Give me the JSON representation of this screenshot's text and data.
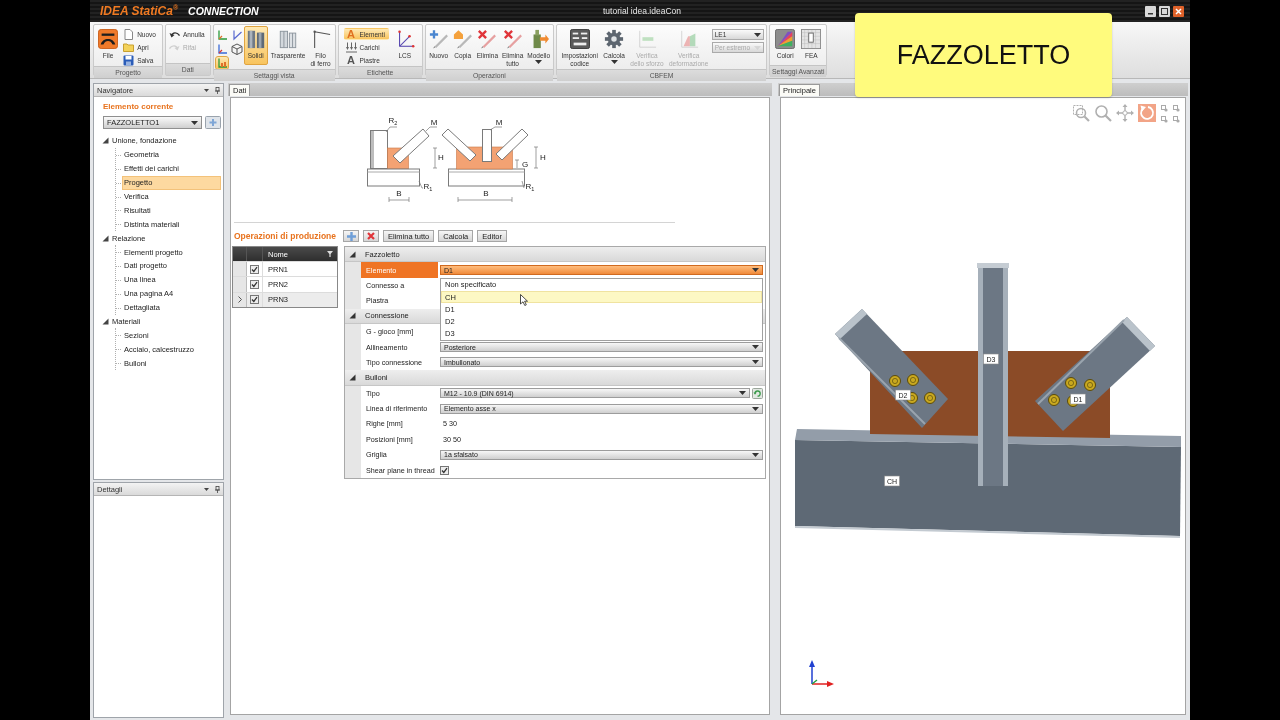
{
  "title_bar": {
    "brand": "IDEA StatiCa$^{®}$",
    "product": "CONNECTION",
    "title": "tutorial idea.ideaCon"
  },
  "ribbon": {
    "groups": [
      {
        "label": "Progetto",
        "items": [
          {
            "kind": "large",
            "label": "File",
            "selected": false,
            "disabled": false
          },
          {
            "kind": "small",
            "label": "Nuovo",
            "selected": false,
            "disabled": false
          },
          {
            "kind": "small",
            "label": "Apri",
            "selected": false,
            "disabled": false
          },
          {
            "kind": "small",
            "label": "Salva",
            "selected": false,
            "disabled": false
          }
        ]
      },
      {
        "label": "Dati",
        "items": [
          {
            "kind": "small",
            "label": "Annulla",
            "selected": false,
            "disabled": false
          },
          {
            "kind": "small",
            "label": "Rifai",
            "selected": false,
            "disabled": true
          }
        ]
      },
      {
        "label": "Settaggi vista",
        "items": [
          {
            "kind": "icon",
            "selected": false,
            "disabled": false
          },
          {
            "kind": "icon",
            "selected": false,
            "disabled": false
          },
          {
            "kind": "icon",
            "selected": false,
            "disabled": false
          },
          {
            "kind": "icon",
            "selected": false,
            "disabled": false
          },
          {
            "kind": "icon",
            "selected": true,
            "disabled": false
          },
          {
            "kind": "large",
            "label": "Solidi",
            "selected": true,
            "disabled": false
          },
          {
            "kind": "large",
            "label": "Trasparente",
            "selected": false,
            "disabled": false
          },
          {
            "kind": "large",
            "label": "Filo\ndi ferro",
            "selected": false,
            "disabled": false
          }
        ]
      },
      {
        "label": "Etichette",
        "items": [
          {
            "kind": "small",
            "label": "Elementi",
            "glyph": "A",
            "selected": true,
            "disabled": false
          },
          {
            "kind": "small",
            "label": "Carichi",
            "selected": false,
            "disabled": false
          },
          {
            "kind": "small",
            "label": "Piastre",
            "glyph": "A",
            "selected": false,
            "disabled": false
          },
          {
            "kind": "large",
            "label": "LCS",
            "selected": false,
            "disabled": false
          }
        ]
      },
      {
        "label": "Operazioni",
        "items": [
          {
            "kind": "large",
            "label": "Nuovo",
            "selected": false,
            "disabled": false
          },
          {
            "kind": "large",
            "label": "Copia",
            "selected": false,
            "disabled": false
          },
          {
            "kind": "large",
            "label": "Elimina",
            "selected": false,
            "disabled": false
          },
          {
            "kind": "large",
            "label": "Elimina\ntutto",
            "selected": false,
            "disabled": false
          },
          {
            "kind": "large",
            "label": "Modello",
            "menu": true,
            "selected": false,
            "disabled": false
          }
        ]
      },
      {
        "label": "CBFEM",
        "items": [
          {
            "kind": "large",
            "label": "Impostazioni\ncodice",
            "selected": false,
            "disabled": false
          },
          {
            "kind": "large",
            "label": "Calcola",
            "menu": true,
            "selected": false,
            "disabled": false
          },
          {
            "kind": "large",
            "label": "Verifica\ndello sforzo",
            "selected": false,
            "disabled": true
          },
          {
            "kind": "large",
            "label": "Verifica\ndeformazione",
            "selected": false,
            "disabled": true
          },
          {
            "kind": "combo",
            "label": "LE1",
            "disabled": false
          },
          {
            "kind": "combo",
            "label": "Per estremo",
            "disabled": true
          }
        ]
      },
      {
        "label": "Settaggi Avanzati",
        "items": [
          {
            "kind": "large",
            "label": "Colori",
            "selected": false,
            "disabled": false
          },
          {
            "kind": "large",
            "label": "FEA",
            "selected": false,
            "disabled": false
          }
        ]
      }
    ]
  },
  "navigator": {
    "title": "Navigatore",
    "current_label": "Elemento corrente",
    "current_value": "FAZZOLETTO1",
    "tree": [
      {
        "label": "Unione, fondazione",
        "expanded": true,
        "selected": false,
        "children": [
          {
            "label": "Geometria",
            "selected": false
          },
          {
            "label": "Effetti dei carichi",
            "selected": false
          },
          {
            "label": "Progetto",
            "selected": true
          },
          {
            "label": "Verifica",
            "selected": false
          },
          {
            "label": "Risultati",
            "selected": false
          },
          {
            "label": "Distinta materiali",
            "selected": false
          }
        ]
      },
      {
        "label": "Relazione",
        "expanded": true,
        "selected": false,
        "children": [
          {
            "label": "Elementi progetto",
            "selected": false
          },
          {
            "label": "Dati progetto",
            "selected": false
          },
          {
            "label": "Una linea",
            "selected": false
          },
          {
            "label": "Una pagina A4",
            "selected": false
          },
          {
            "label": "Dettagliata",
            "selected": false
          }
        ]
      },
      {
        "label": "Materiali",
        "expanded": true,
        "selected": false,
        "children": [
          {
            "label": "Sezioni",
            "selected": false
          },
          {
            "label": "Acciaio, calcestruzzo",
            "selected": false
          },
          {
            "label": "Bulloni",
            "selected": false
          }
        ]
      }
    ]
  },
  "details_panel": {
    "title": "Dettagli"
  },
  "data_panel": {
    "tab": "Dati",
    "schematic": {
      "sketches": [
        {
          "labels": [
            "R$_{2}$",
            "M",
            "H",
            "B",
            "R$_{1}$"
          ]
        },
        {
          "labels": [
            "M",
            "H",
            "G",
            "B",
            "R$_{1}$"
          ]
        }
      ]
    },
    "operations": {
      "title": "Operazioni di produzione",
      "buttons": [
        {
          "kind": "add"
        },
        {
          "kind": "delete"
        },
        {
          "kind": "text",
          "label": "Elimina tutto"
        },
        {
          "kind": "text",
          "label": "Calcola"
        },
        {
          "kind": "text",
          "label": "Editor"
        }
      ]
    },
    "table": {
      "columns": [
        "Nome"
      ],
      "rows": [
        {
          "name": "PRN1",
          "checked": true,
          "selected": false
        },
        {
          "name": "PRN2",
          "checked": true,
          "selected": false
        },
        {
          "name": "PRN3",
          "checked": true,
          "selected": true
        }
      ]
    },
    "properties": {
      "categories": [
        {
          "label": "Fazzoletto",
          "expanded": true,
          "rows": [
            {
              "name": "Elemento",
              "kind": "combo",
              "value": "D1",
              "selected": true,
              "open": true,
              "options": [
                {
                  "label": "Non specificato",
                  "highlighted": false
                },
                {
                  "label": "CH",
                  "highlighted": true
                },
                {
                  "label": "D1",
                  "highlighted": false
                },
                {
                  "label": "D2",
                  "highlighted": false
                },
                {
                  "label": "D3",
                  "highlighted": false
                }
              ]
            },
            {
              "name": "Connesso a",
              "kind": "text",
              "selected": false
            },
            {
              "name": "Piastra",
              "kind": "text",
              "selected": false
            }
          ]
        },
        {
          "label": "Connessione",
          "expanded": true,
          "rows": [
            {
              "name": "G - gioco [mm]",
              "kind": "text",
              "selected": false
            },
            {
              "name": "Allineamento",
              "kind": "combo",
              "value": "Posteriore",
              "selected": false
            },
            {
              "name": "Tipo connessione",
              "kind": "combo",
              "value": "Imbullonato",
              "selected": false
            }
          ]
        },
        {
          "label": "Bulloni",
          "expanded": true,
          "rows": [
            {
              "name": "Tipo",
              "kind": "combo_button",
              "value": "M12 - 10.9 (DIN 6914)",
              "selected": false
            },
            {
              "name": "Linea di riferimento",
              "kind": "combo",
              "value": "Elemento asse x",
              "selected": false
            },
            {
              "name": "Righe [mm]",
              "kind": "text",
              "value": "5 30",
              "selected": false
            },
            {
              "name": "Posizioni [mm]",
              "kind": "text",
              "value": "30 50",
              "selected": false
            },
            {
              "name": "Griglia",
              "kind": "combo",
              "value": "1a sfalsato",
              "selected": false
            },
            {
              "name": "Shear plane in thread",
              "kind": "checkbox",
              "checked": true,
              "selected": false
            }
          ]
        }
      ]
    }
  },
  "view_panel": {
    "tab": "Principale",
    "toolbar": [
      {
        "selected": false
      },
      {
        "selected": false
      },
      {
        "selected": false
      },
      {
        "selected": true
      },
      {
        "selected": false
      },
      {
        "selected": false
      },
      {
        "selected": false
      },
      {
        "selected": false
      }
    ],
    "model": {
      "labels": [
        "CH",
        "D3",
        "D2",
        "D1"
      ]
    }
  },
  "caption": {
    "text": "FAZZOLETTO"
  }
}
